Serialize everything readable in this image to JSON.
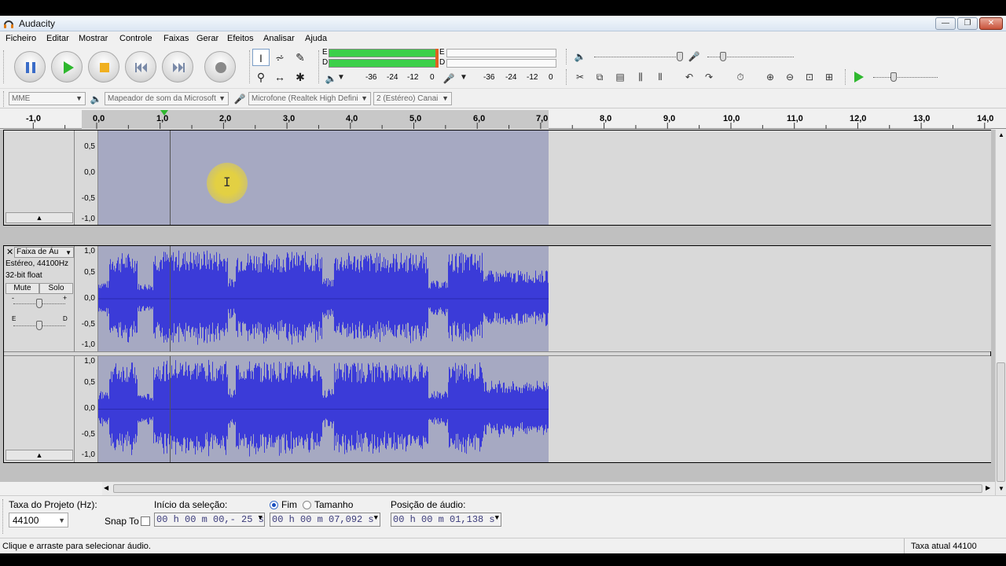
{
  "window": {
    "title": "Audacity"
  },
  "menu": [
    "Ficheiro",
    "Editar",
    "Mostrar",
    "Controle",
    "Faixas",
    "Gerar",
    "Efeitos",
    "Analisar",
    "Ajuda"
  ],
  "meters": {
    "play_channel_e": "E",
    "play_channel_d": "D",
    "rec_channel_e": "E",
    "rec_channel_d": "D",
    "play_scale": [
      "-36",
      "-24",
      "-12",
      "0"
    ],
    "rec_scale": [
      "-36",
      "-24",
      "-12",
      "0"
    ]
  },
  "device_toolbar": {
    "host": "MME",
    "output": "Mapeador de som da Microsoft",
    "input": "Microfone (Realtek High Defini",
    "channels": "2 (Estéreo) Canai"
  },
  "ruler": {
    "labels": [
      "-1,0",
      "0,0",
      "1,0",
      "2,0",
      "3,0",
      "4,0",
      "5,0",
      "6,0",
      "7,0",
      "8,0",
      "9,0",
      "10,0",
      "11,0",
      "12,0",
      "13,0",
      "14,0"
    ]
  },
  "tracks": {
    "top_track_scale": [
      "0,5",
      "0,0",
      "-0,5",
      "-1,0"
    ],
    "audio_track": {
      "name": "Faixa de Áu",
      "format_line1": "Estéreo, 44100Hz",
      "format_line2": "32-bit float",
      "mute": "Mute",
      "solo": "Solo",
      "gain_minus": "-",
      "gain_plus": "+",
      "pan_left": "E",
      "pan_right": "D",
      "scale": [
        "1,0",
        "0,5",
        "0,0",
        "-0,5",
        "-1,0"
      ]
    }
  },
  "selection_bar": {
    "project_rate_label": "Taxa do Projeto (Hz):",
    "project_rate_value": "44100",
    "snap_to": "Snap To",
    "start_label": "Início da seleção:",
    "start_value": "00 h 00 m 00,- 25 s",
    "end_radio": "Fim",
    "length_radio": "Tamanho",
    "end_value": "00 h 00 m 07,092 s",
    "position_label": "Posição de áudio:",
    "position_value": "00 h 00 m 01,138 s"
  },
  "status": {
    "message": "Clique e arraste para selecionar áudio.",
    "rate": "Taxa atual 44100"
  },
  "colors": {
    "waveform": "#3b3bd8",
    "selection": "#a6a9c2",
    "meter_green": "#3cd04a"
  }
}
